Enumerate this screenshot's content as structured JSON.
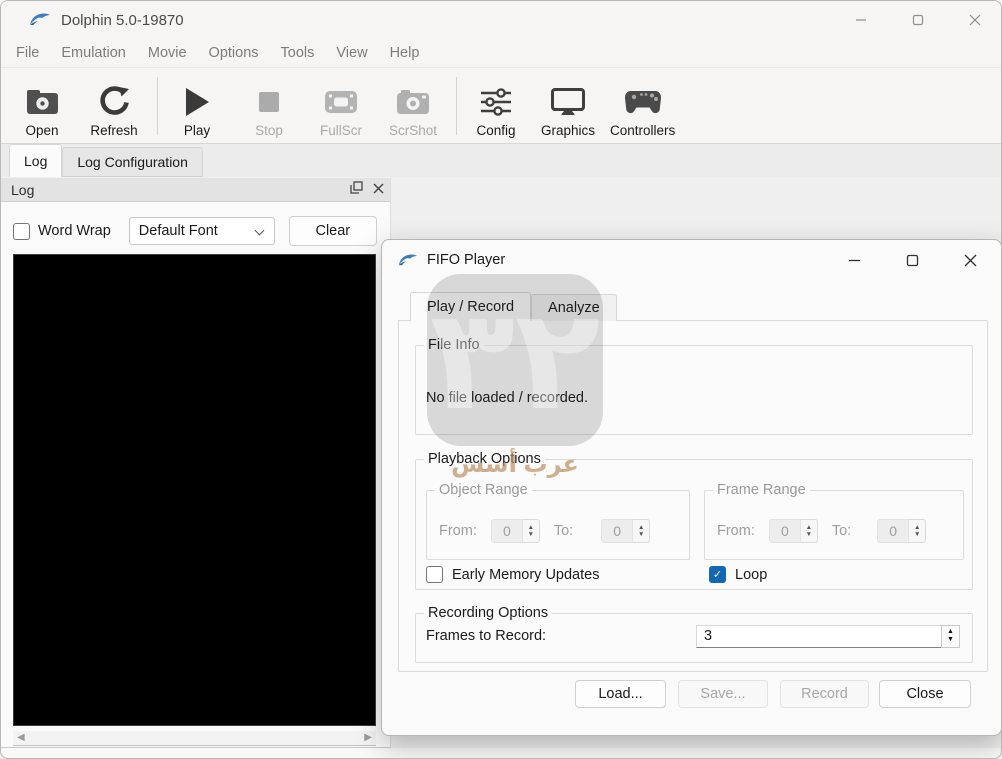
{
  "window": {
    "title": "Dolphin 5.0-19870"
  },
  "menu": {
    "items": [
      "File",
      "Emulation",
      "Movie",
      "Options",
      "Tools",
      "View",
      "Help"
    ]
  },
  "toolbar": {
    "buttons": [
      {
        "label": "Open",
        "icon": "open-icon",
        "enabled": true
      },
      {
        "label": "Refresh",
        "icon": "refresh-icon",
        "enabled": true
      },
      {
        "label": "Play",
        "icon": "play-icon",
        "enabled": true
      },
      {
        "label": "Stop",
        "icon": "stop-icon",
        "enabled": false
      },
      {
        "label": "FullScr",
        "icon": "fullscreen-icon",
        "enabled": false
      },
      {
        "label": "ScrShot",
        "icon": "screenshot-icon",
        "enabled": false
      },
      {
        "label": "Config",
        "icon": "config-icon",
        "enabled": true
      },
      {
        "label": "Graphics",
        "icon": "graphics-icon",
        "enabled": true
      },
      {
        "label": "Controllers",
        "icon": "controllers-icon",
        "enabled": true
      }
    ]
  },
  "log_tabs": {
    "items": [
      "Log",
      "Log Configuration"
    ]
  },
  "log_panel": {
    "title": "Log",
    "word_wrap": "Word Wrap",
    "font_select": "Default Font",
    "clear": "Clear"
  },
  "fifo": {
    "title": "FIFO Player",
    "tabs": [
      "Play / Record",
      "Analyze"
    ],
    "file_info": {
      "title": "File Info",
      "message": "No file loaded / recorded."
    },
    "playback": {
      "title": "Playback Options",
      "object_range": {
        "title": "Object Range",
        "from_label": "From:",
        "from_value": "0",
        "to_label": "To:",
        "to_value": "0"
      },
      "frame_range": {
        "title": "Frame Range",
        "from_label": "From:",
        "from_value": "0",
        "to_label": "To:",
        "to_value": "0"
      },
      "early_memory": "Early Memory Updates",
      "loop": "Loop"
    },
    "recording": {
      "title": "Recording Options",
      "frames_label": "Frames to Record:",
      "frames_value": "3"
    },
    "buttons": {
      "load": "Load...",
      "save": "Save...",
      "record": "Record",
      "close": "Close"
    }
  },
  "watermark": {
    "emblem": "٣٢",
    "text": "عرب أسس"
  },
  "colors": {
    "accent": "#1268b3",
    "loop_checkbox": "#1268b3",
    "dolphin_blue": "#3c7cc0"
  }
}
